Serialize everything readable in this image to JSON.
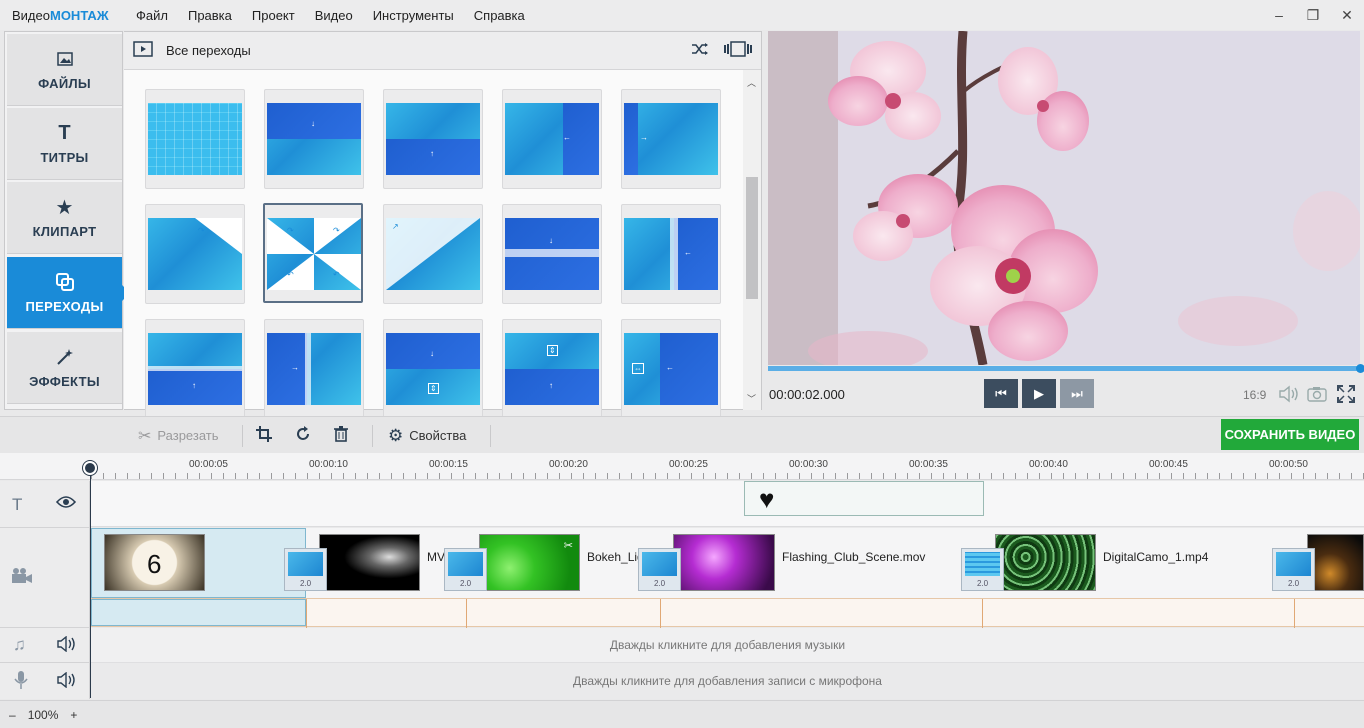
{
  "app": {
    "title_prefix": "Видео",
    "title_brand": "МОНТАЖ"
  },
  "menu": [
    "Файл",
    "Правка",
    "Проект",
    "Видео",
    "Инструменты",
    "Справка"
  ],
  "window_controls": {
    "minimize": "–",
    "maximize": "❐",
    "close": "✕"
  },
  "nav": [
    {
      "label": "ФАЙЛЫ",
      "icon": "image-icon"
    },
    {
      "label": "ТИТРЫ",
      "icon": "title-t-icon"
    },
    {
      "label": "КЛИПАРТ",
      "icon": "star-icon"
    },
    {
      "label": "ПЕРЕХОДЫ",
      "icon": "transitions-icon",
      "active": true
    },
    {
      "label": "ЭФФЕКТЫ",
      "icon": "magic-wand-icon"
    }
  ],
  "transitions": {
    "category": "Все переходы"
  },
  "preview": {
    "timecode": "00:00:02.000",
    "ratio": "16:9"
  },
  "toolbar": {
    "cut": "Разрезать",
    "properties": "Свойства",
    "save": "СОХРАНИТЬ ВИДЕО"
  },
  "ruler": [
    "00:00:05",
    "00:00:10",
    "00:00:15",
    "00:00:20",
    "00:00:25",
    "00:00:30",
    "00:00:35",
    "00:00:40",
    "00:00:45",
    "00:00:50"
  ],
  "clips": [
    {
      "name": "MV",
      "thumb": "countdown"
    },
    {
      "name": "Bokeh_Lig",
      "thumb": "green-bokeh"
    },
    {
      "name": "Flashing_Club_Scene.mov",
      "thumb": "club"
    },
    {
      "name": "DigitalCamo_1.mp4",
      "thumb": "camo"
    }
  ],
  "transition_durations": [
    "2.0",
    "2.0",
    "2.0",
    "2.0",
    "2.0"
  ],
  "countdown_number": "6",
  "music_hint": "Дважды кликните для добавления музыки",
  "mic_hint": "Дважды кликните для добавления записи с микрофона",
  "zoom": {
    "minus": "–",
    "value": "100%",
    "plus": "+"
  },
  "colors": {
    "accent": "#1a8bd8",
    "save": "#22a93a",
    "player_btn": "#3c4d5f"
  }
}
